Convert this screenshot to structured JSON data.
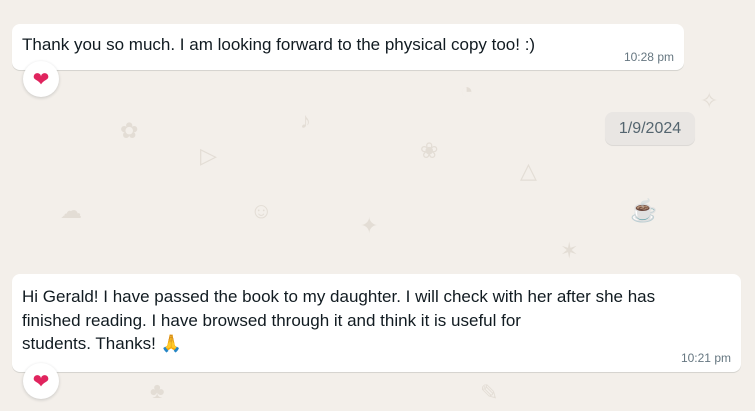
{
  "messages": [
    {
      "text": "Thank you so much. I am looking forward to the physical copy too! :)",
      "time": "10:28 pm",
      "reaction": "❤"
    },
    {
      "text_line1": "Hi Gerald! I have passed the book to my daughter. I will check with her after she has",
      "text_line2": "finished reading. I have browsed through it and think it is useful for",
      "text_line3": "students. Thanks! ",
      "emoji": "🙏",
      "time": "10:21 pm",
      "reaction": "❤"
    }
  ],
  "date_separator": "1/9/2024",
  "colors": {
    "background": "#f3efea",
    "bubble": "#ffffff",
    "timestamp": "#667781",
    "heart": "#e0245e"
  }
}
